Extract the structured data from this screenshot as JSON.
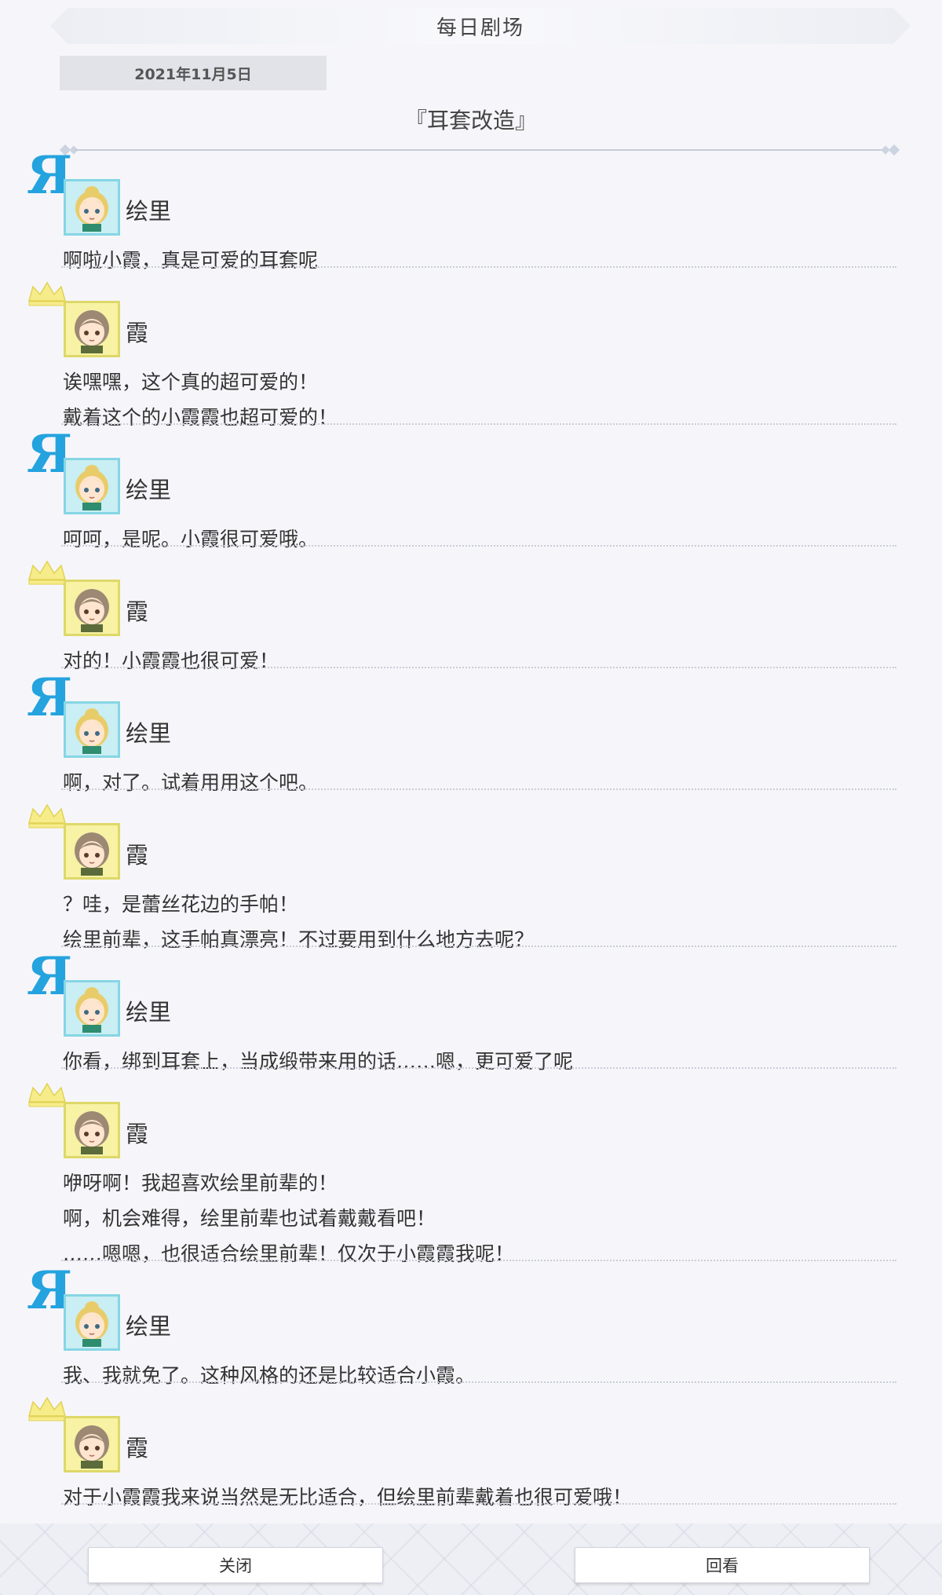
{
  "header": {
    "title": "每日剧场"
  },
  "date": "2021年11月5日",
  "story_title": "『耳套改造』",
  "colors": {
    "eli_accent": "#24a3de",
    "kasumi_crown": "#f2e56b",
    "eli_avatar_bg": "#c9eef3",
    "kasumi_avatar_bg": "#f7f2a4"
  },
  "entries": [
    {
      "speaker": "绘里",
      "emblem": "r-emblem-icon",
      "lines": [
        "啊啦小霞，真是可爱的耳套呢"
      ]
    },
    {
      "speaker": "霞",
      "emblem": "crown-icon",
      "lines": [
        "诶嘿嘿，这个真的超可爱的！",
        "戴着这个的小霞霞也超可爱的！"
      ]
    },
    {
      "speaker": "绘里",
      "emblem": "r-emblem-icon",
      "lines": [
        "呵呵，是呢。小霞很可爱哦。"
      ]
    },
    {
      "speaker": "霞",
      "emblem": "crown-icon",
      "lines": [
        "对的！小霞霞也很可爱！"
      ]
    },
    {
      "speaker": "绘里",
      "emblem": "r-emblem-icon",
      "lines": [
        "啊，对了。试着用用这个吧。"
      ]
    },
    {
      "speaker": "霞",
      "emblem": "crown-icon",
      "lines": [
        "？哇，是蕾丝花边的手帕！",
        "绘里前辈，这手帕真漂亮！不过要用到什么地方去呢？"
      ]
    },
    {
      "speaker": "绘里",
      "emblem": "r-emblem-icon",
      "lines": [
        "你看，绑到耳套上，当成缎带来用的话……嗯，更可爱了呢"
      ]
    },
    {
      "speaker": "霞",
      "emblem": "crown-icon",
      "lines": [
        "咿呀啊！我超喜欢绘里前辈的！",
        "啊，机会难得，绘里前辈也试着戴戴看吧！",
        "……嗯嗯，也很适合绘里前辈！仅次于小霞霞我呢！"
      ]
    },
    {
      "speaker": "绘里",
      "emblem": "r-emblem-icon",
      "lines": [
        "我、我就免了。这种风格的还是比较适合小霞。"
      ]
    },
    {
      "speaker": "霞",
      "emblem": "crown-icon",
      "lines": [
        "对于小霞霞我来说当然是无比适合，但绘里前辈戴着也很可爱哦！"
      ]
    }
  ],
  "buttons": {
    "close": "关闭",
    "replay": "回看"
  }
}
